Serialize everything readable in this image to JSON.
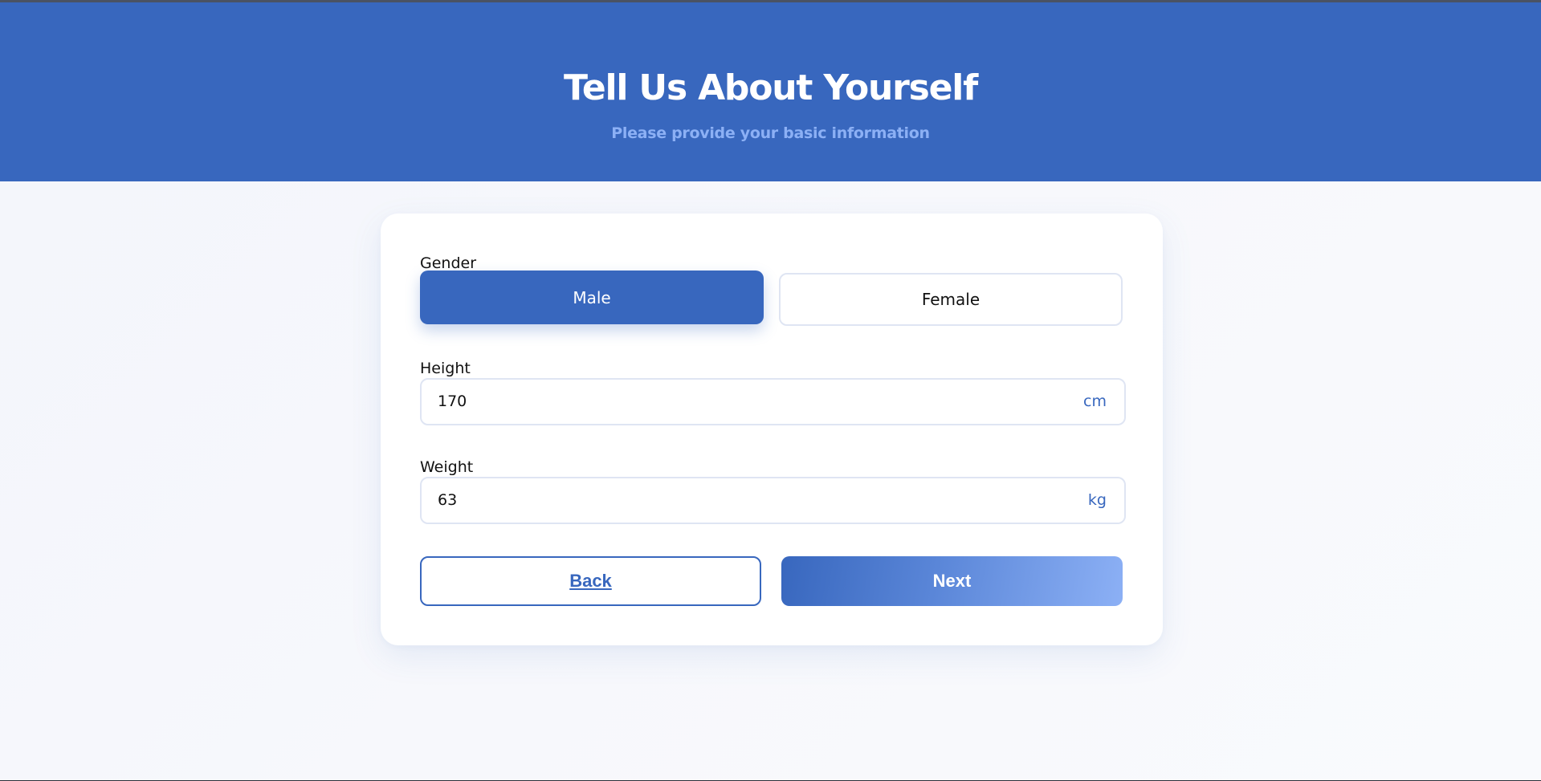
{
  "header": {
    "title": "Tell Us About Yourself",
    "subtitle": "Please provide your basic information"
  },
  "form": {
    "gender": {
      "label": "Gender",
      "options": [
        "Male",
        "Female"
      ],
      "selected": "Male"
    },
    "height": {
      "label": "Height",
      "value": "170",
      "unit": "cm"
    },
    "weight": {
      "label": "Weight",
      "value": "63",
      "unit": "kg"
    }
  },
  "actions": {
    "back_label": "Back",
    "next_label": "Next"
  },
  "colors": {
    "primary": "#3867be",
    "accent_light": "#8cb0f5",
    "border": "#dfe5f3"
  }
}
